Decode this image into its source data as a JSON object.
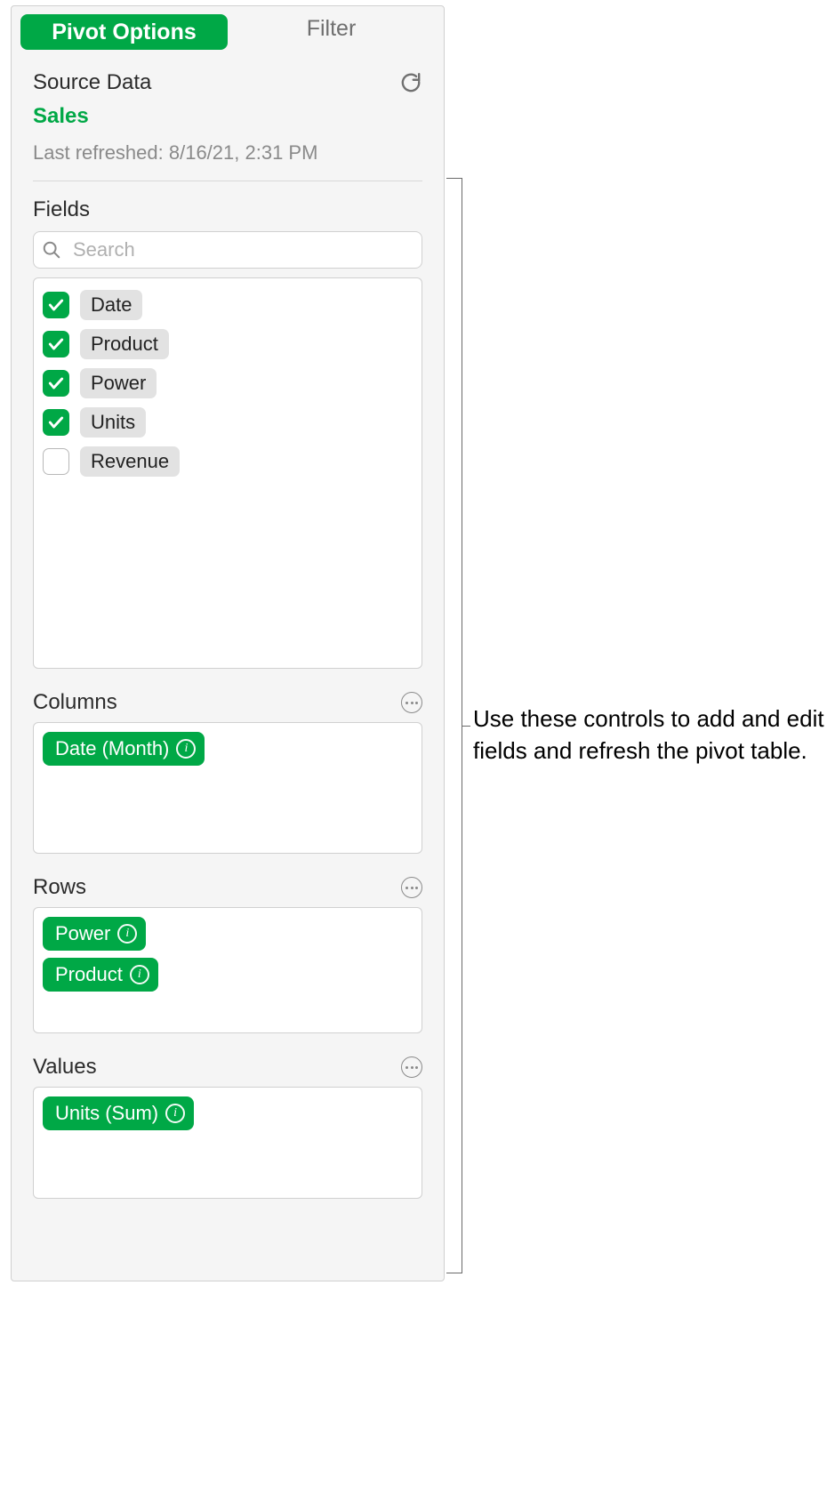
{
  "colors": {
    "accent": "#00a846",
    "chip": "#e2e2e2",
    "muted": "#8a8a8a"
  },
  "tabs": {
    "pivot_options": "Pivot Options",
    "filter": "Filter"
  },
  "source": {
    "label": "Source Data",
    "name": "Sales",
    "refreshed": "Last refreshed: 8/16/21, 2:31 PM"
  },
  "fields": {
    "label": "Fields",
    "search_placeholder": "Search",
    "items": [
      {
        "label": "Date",
        "checked": true
      },
      {
        "label": "Product",
        "checked": true
      },
      {
        "label": "Power",
        "checked": true
      },
      {
        "label": "Units",
        "checked": true
      },
      {
        "label": "Revenue",
        "checked": false
      }
    ]
  },
  "zones": {
    "columns": {
      "label": "Columns",
      "pills": [
        "Date (Month)"
      ]
    },
    "rows": {
      "label": "Rows",
      "pills": [
        "Power",
        "Product"
      ]
    },
    "values": {
      "label": "Values",
      "pills": [
        "Units (Sum)"
      ]
    }
  },
  "callout": "Use these controls to add and edit fields and refresh the pivot table."
}
